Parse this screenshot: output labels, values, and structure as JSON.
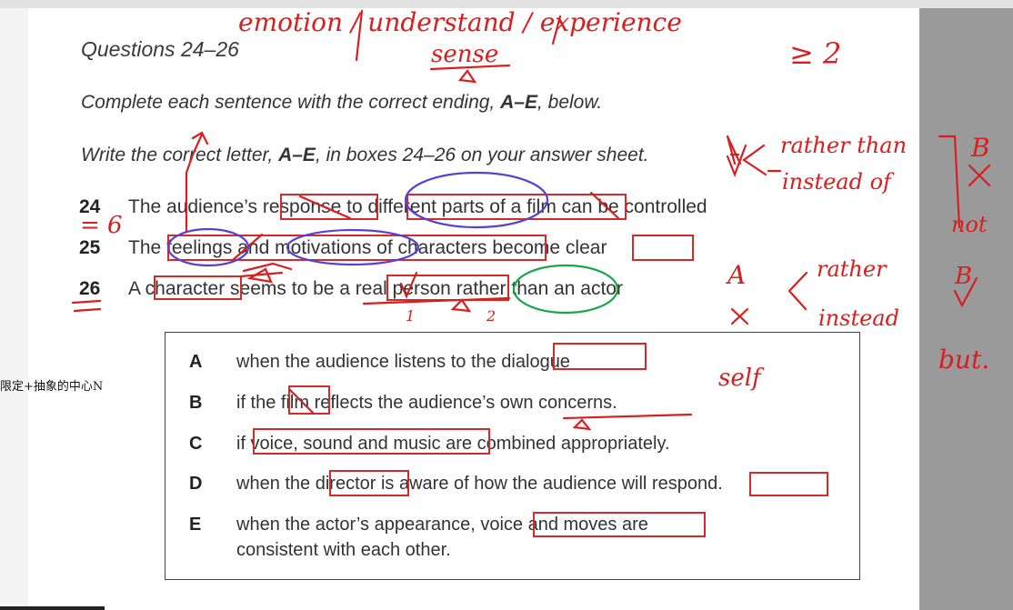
{
  "side_note": "限定+抽象的中心N",
  "document": {
    "heading": "Questions 24–26",
    "instruction_1": {
      "pre": "Complete each sentence with the correct ending, ",
      "bold": "A–E",
      "post": ", below."
    },
    "instruction_2": {
      "pre": "Write the correct letter, ",
      "bold": "A–E",
      "post": ", in boxes 24–26 on your answer sheet."
    },
    "questions": [
      {
        "number": "24",
        "text": "The audience’s response to different parts of a film can be controlled"
      },
      {
        "number": "25",
        "text": "The feelings and motivations of characters become clear"
      },
      {
        "number": "26",
        "text": "A character seems to be a real person rather than an actor"
      }
    ],
    "options": [
      {
        "letter": "A",
        "text": "when the audience listens to the dialogue"
      },
      {
        "letter": "B",
        "text": "if the film reflects the audience’s own concerns."
      },
      {
        "letter": "C",
        "text": "if voice, sound and music are combined appropriately."
      },
      {
        "letter": "D",
        "text": "when the director is aware of how the audience will respond."
      },
      {
        "letter": "E",
        "text": "when the actor’s appearance, voice and moves are",
        "text2": "consistent with each other."
      }
    ]
  },
  "annotations": {
    "top_words": "emotion / understand / experience",
    "sense": "sense",
    "ge2": "≥ 2",
    "eq6": "= 6",
    "rather_than": "rather than",
    "instead_of": "instead of",
    "B_label": "B",
    "not": "not",
    "rather": "rather",
    "instead": "instead",
    "but": "but.",
    "self": "self",
    "num1": "1",
    "num2": "2",
    "A_label": "A",
    "colors": {
      "red_ink": "#d81e1e",
      "box_red": "#d42a2a",
      "circle_blue": "#5a3fd6",
      "circle_green": "#19a64a"
    }
  }
}
